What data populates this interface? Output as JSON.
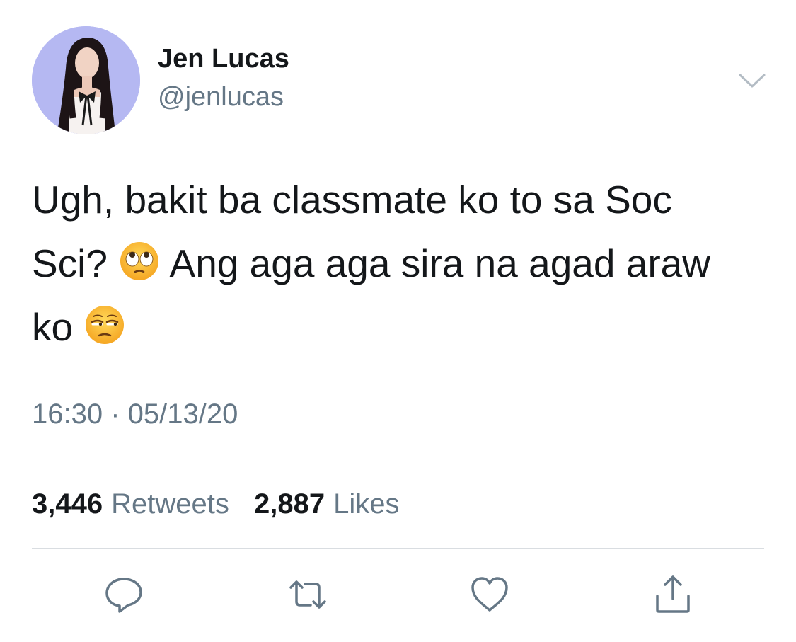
{
  "user": {
    "display_name": "Jen Lucas",
    "handle": "@jenlucas"
  },
  "tweet": {
    "lines": [
      {
        "parts": [
          "Ugh, bakit ba classmate ko to sa Soc"
        ]
      },
      {
        "parts": [
          "Sci?",
          "Ang aga aga sira na agad araw"
        ]
      },
      {
        "parts": [
          "ko"
        ]
      }
    ],
    "emojis": [
      "face-with-rolling-eyes",
      "unamused-face"
    ],
    "timestamp": "16:30 · 05/13/20"
  },
  "stats": {
    "retweets_count": "3,446",
    "retweets_label": "Retweets",
    "likes_count": "2,887",
    "likes_label": "Likes"
  },
  "actions": {
    "reply_icon": "reply-icon",
    "retweet_icon": "retweet-icon",
    "like_icon": "heart-icon",
    "share_icon": "share-icon"
  },
  "colors": {
    "text_primary": "#14171a",
    "text_secondary": "#657786",
    "divider": "#d9dde1",
    "icon": "#657786"
  }
}
